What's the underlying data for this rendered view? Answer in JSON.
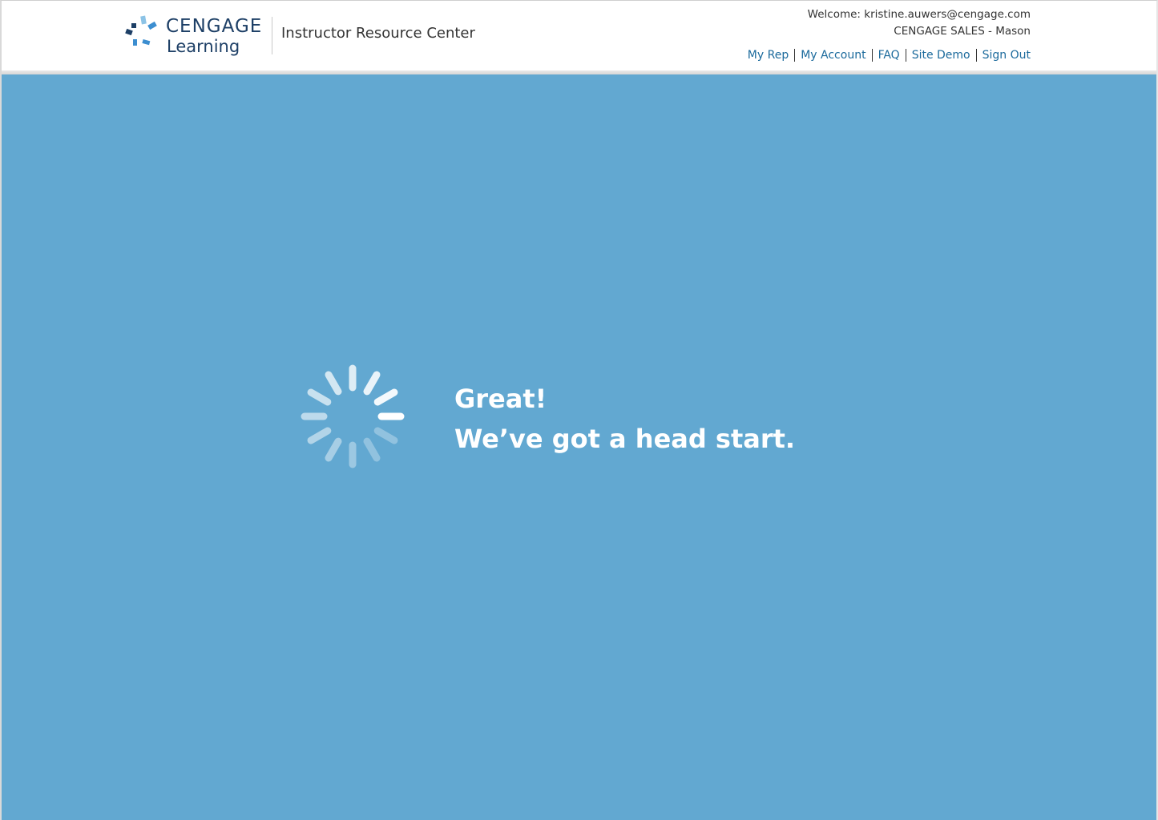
{
  "brand": {
    "logo_line1": "CENGAGE",
    "logo_line2": "Learning",
    "site_title": "Instructor Resource Center"
  },
  "user": {
    "welcome": "Welcome: kristine.auwers@cengage.com",
    "org": "CENGAGE SALES - Mason"
  },
  "nav": {
    "my_rep": "My Rep",
    "my_account": "My Account",
    "faq": "FAQ",
    "site_demo": "Site Demo",
    "sign_out": "Sign Out"
  },
  "loading": {
    "line1": "Great!",
    "line2": "We’ve got a head start."
  },
  "colors": {
    "background": "#62a8d1",
    "link": "#1b6a9c",
    "logo_text": "#1d3f66",
    "message_text": "#ffffff"
  },
  "icons": {
    "logo": "cengage-logo-icon",
    "spinner": "loading-spinner-icon"
  }
}
